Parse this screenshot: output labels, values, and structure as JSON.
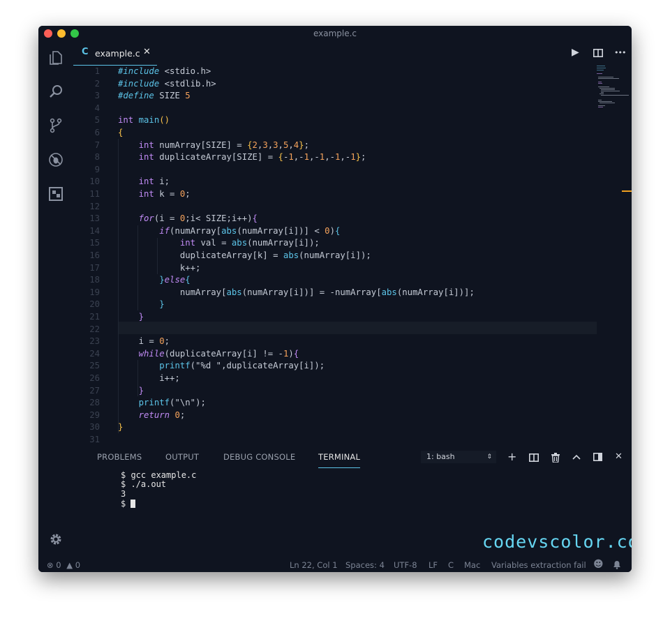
{
  "window": {
    "title": "example.c"
  },
  "tab": {
    "lang_icon": "C",
    "name": "example.c",
    "close": "✕"
  },
  "editor_actions": {
    "run": "▶",
    "split": "split-icon",
    "more": "•••"
  },
  "code": [
    {
      "n": "1",
      "html": "<span class='dir'>#include</span> &lt;stdio.h&gt;"
    },
    {
      "n": "2",
      "html": "<span class='dir'>#include</span> &lt;stdlib.h&gt;"
    },
    {
      "n": "3",
      "html": "<span class='dir'>#define</span> SIZE <span class='num'>5</span>"
    },
    {
      "n": "4",
      "html": ""
    },
    {
      "n": "5",
      "html": "<span class='kw'>int</span> <span class='fn'>main</span><span class='br'>()</span>"
    },
    {
      "n": "6",
      "html": "<span class='br'>{</span>"
    },
    {
      "n": "7",
      "html": "    <span class='kw'>int</span> numArray[SIZE] = <span class='br'>{</span><span class='num'>2</span>,<span class='num'>3</span>,<span class='num'>3</span>,<span class='num'>5</span>,<span class='num'>4</span><span class='br'>}</span>;"
    },
    {
      "n": "8",
      "html": "    <span class='kw'>int</span> duplicateArray[SIZE] = <span class='br'>{</span>-<span class='num'>1</span>,-<span class='num'>1</span>,-<span class='num'>1</span>,-<span class='num'>1</span>,-<span class='num'>1</span><span class='br'>}</span>;"
    },
    {
      "n": "9",
      "html": ""
    },
    {
      "n": "10",
      "html": "    <span class='kw'>int</span> i;"
    },
    {
      "n": "11",
      "html": "    <span class='kw'>int</span> k = <span class='num'>0</span>;"
    },
    {
      "n": "12",
      "html": ""
    },
    {
      "n": "13",
      "html": "    <span class='kwi'>for</span>(i = <span class='num'>0</span>;i&lt; SIZE;i++)<span class='kw'>{</span>"
    },
    {
      "n": "14",
      "html": "        <span class='kwi'>if</span>(numArray[<span class='fn'>abs</span>(numArray[i])] &lt; <span class='num'>0</span>)<span class='fn'>{</span>"
    },
    {
      "n": "15",
      "html": "            <span class='kw'>int</span> val = <span class='fn'>abs</span>(numArray[i]);"
    },
    {
      "n": "16",
      "html": "            duplicateArray[k] = <span class='fn'>abs</span>(numArray[i]);"
    },
    {
      "n": "17",
      "html": "            k++;"
    },
    {
      "n": "18",
      "html": "        <span class='fn'>}</span><span class='kwi'>else</span><span class='fn'>{</span>"
    },
    {
      "n": "19",
      "html": "            numArray[<span class='fn'>abs</span>(numArray[i])] = -numArray[<span class='fn'>abs</span>(numArray[i])];"
    },
    {
      "n": "20",
      "html": "        <span class='fn'>}</span>"
    },
    {
      "n": "21",
      "html": "    <span class='kw'>}</span>"
    },
    {
      "n": "22",
      "html": ""
    },
    {
      "n": "23",
      "html": "    i = <span class='num'>0</span>;"
    },
    {
      "n": "24",
      "html": "    <span class='kwi'>while</span>(duplicateArray[i] != -<span class='num'>1</span>)<span class='kw'>{</span>"
    },
    {
      "n": "25",
      "html": "        <span class='fn'>printf</span>(\"%d \",duplicateArray[i]);"
    },
    {
      "n": "26",
      "html": "        i++;"
    },
    {
      "n": "27",
      "html": "    <span class='kw'>}</span>"
    },
    {
      "n": "28",
      "html": "    <span class='fn'>printf</span>(\"\\n\");"
    },
    {
      "n": "29",
      "html": "    <span class='kwi'>return</span> <span class='num'>0</span>;"
    },
    {
      "n": "30",
      "html": "<span class='br'>}</span>"
    },
    {
      "n": "31",
      "html": ""
    }
  ],
  "panel": {
    "tabs": [
      "PROBLEMS",
      "OUTPUT",
      "DEBUG CONSOLE",
      "TERMINAL"
    ],
    "active_tab": "TERMINAL",
    "shell_select": "1: bash",
    "terminal_lines": [
      "$ gcc example.c",
      "$ ./a.out",
      "3",
      "$ "
    ]
  },
  "status": {
    "errors": "0",
    "warnings": "0",
    "position": "Ln 22, Col 1",
    "spaces": "Spaces: 4",
    "encoding": "UTF-8",
    "eol": "LF",
    "language": "C",
    "os": "Mac",
    "message": "Variables extraction fail"
  },
  "watermark": "codevscolor.com",
  "colors": {
    "background": "#0f1420",
    "accent": "#5cc4e8",
    "keyword": "#c18bf5",
    "number": "#f6a35c"
  }
}
